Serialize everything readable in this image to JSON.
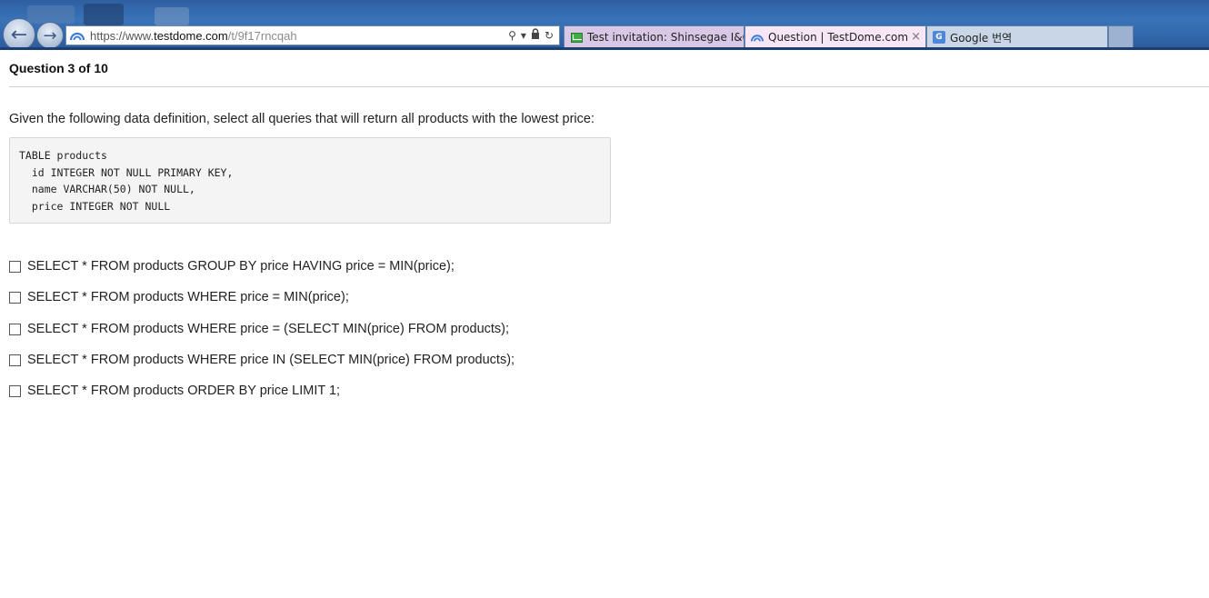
{
  "browser": {
    "url": {
      "scheme": "https://www.",
      "domain": "testdome.com",
      "path": "/t/9f17rncqah"
    },
    "back_icon": "back-arrow-icon",
    "forward_icon": "forward-arrow-icon",
    "tabs": [
      {
        "label": "Test invitation: Shinsegae I&C...",
        "icon": "mail-icon",
        "color": "#d9c7e6"
      },
      {
        "label": "Question | TestDome.com",
        "icon": "testdome-icon",
        "color": "#f6e6f6",
        "active": true
      },
      {
        "label": "Google 번역",
        "icon": "google-translate-icon",
        "color": "#c9d6e8"
      }
    ],
    "tab_close": "×"
  },
  "page": {
    "question_header": "Question 3 of 10",
    "question_text": "Given the following data definition, select all queries that will return all products with the lowest price:",
    "code_lines": [
      "TABLE products",
      "  id INTEGER NOT NULL PRIMARY KEY,",
      "  name VARCHAR(50) NOT NULL,",
      "  price INTEGER NOT NULL"
    ],
    "options": [
      {
        "label": "SELECT * FROM products GROUP BY price HAVING price = MIN(price);",
        "checked": false
      },
      {
        "label": "SELECT * FROM products WHERE price = MIN(price);",
        "checked": false
      },
      {
        "label": "SELECT * FROM products WHERE price = (SELECT MIN(price) FROM products);",
        "checked": false
      },
      {
        "label": "SELECT * FROM products WHERE price IN (SELECT MIN(price) FROM products);",
        "checked": false
      },
      {
        "label": "SELECT * FROM products ORDER BY price LIMIT 1;",
        "checked": false
      }
    ]
  }
}
